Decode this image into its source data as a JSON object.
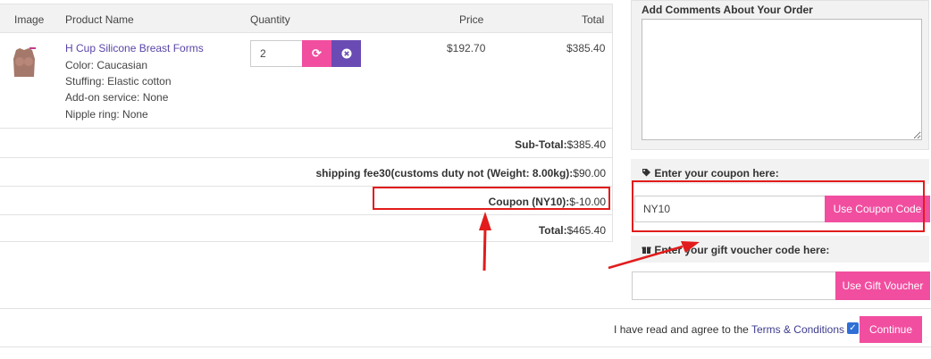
{
  "cart": {
    "headers": {
      "image": "Image",
      "product": "Product Name",
      "quantity": "Quantity",
      "price": "Price",
      "total": "Total"
    },
    "item": {
      "name": "H Cup Silicone Breast Forms",
      "options": [
        "Color: Caucasian",
        "Stuffing: Elastic cotton",
        "Add-on service: None",
        "Nipple ring: None"
      ],
      "quantity": "2",
      "price": "$192.70",
      "total": "$385.40",
      "update_icon": "refresh-icon",
      "remove_icon": "remove-icon"
    },
    "summary": [
      {
        "label": "Sub-Total:",
        "value": "$385.40"
      },
      {
        "label": "shipping fee30(customs duty not (Weight: 8.00kg):",
        "value": "$90.00"
      },
      {
        "label": "Coupon (NY10):",
        "value": "$-10.00"
      },
      {
        "label": "Total:",
        "value": "$465.40"
      }
    ]
  },
  "comments": {
    "label": "Add Comments About Your Order"
  },
  "coupon": {
    "label": "Enter your coupon here:",
    "value": "NY10",
    "button": "Use Coupon Code",
    "icon": "tag-icon"
  },
  "voucher": {
    "label": "Enter your gift voucher code here:",
    "value": "",
    "button": "Use Gift Voucher",
    "icon": "gift-icon"
  },
  "footer": {
    "agree_text": "I have read and agree to the",
    "terms_link": "Terms & Conditions",
    "continue": "Continue"
  },
  "colors": {
    "accent": "#f14ea0",
    "purple": "#6a4bb3",
    "highlight": "#e21c1c",
    "link": "#5a45a8"
  }
}
